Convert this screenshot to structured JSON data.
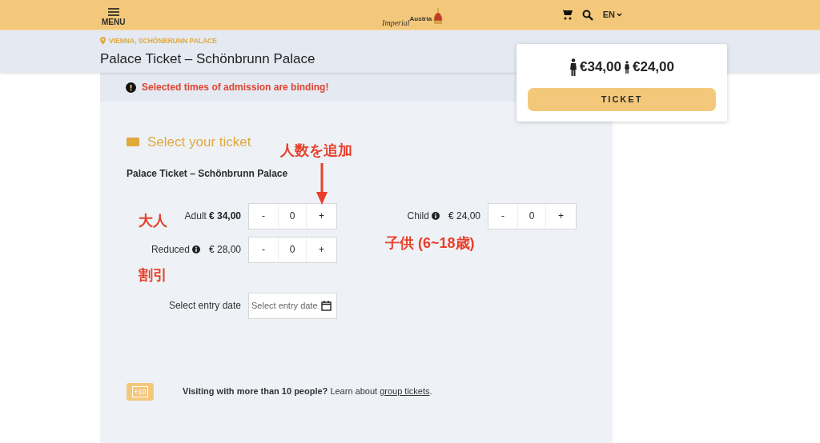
{
  "header": {
    "menu_label": "MENU",
    "logo": {
      "word_1": "Imperial",
      "word_2": "Austria"
    },
    "language": "EN"
  },
  "page": {
    "location": "VIENNA, SCHÖNBRUNN PALACE",
    "title": "Palace Ticket – Schönbrunn Palace"
  },
  "price_card": {
    "prices": [
      {
        "kind": "adult",
        "price": "€34,00"
      },
      {
        "kind": "child",
        "price": "€24,00"
      }
    ],
    "button": "TICKET"
  },
  "notice": "Selected times of admission are binding!",
  "ticket_section": {
    "heading": "Select your ticket",
    "product": "Palace Ticket – Schönbrunn Palace",
    "tickets": [
      {
        "name": "Adult",
        "info": false,
        "price": "€ 34,00",
        "minus": "-",
        "count": "0",
        "plus": "+"
      },
      {
        "name": "Child",
        "info": true,
        "price": "€ 24,00",
        "minus": "-",
        "count": "0",
        "plus": "+"
      },
      {
        "name": "Reduced",
        "info": true,
        "price": "€ 28,00",
        "minus": "-",
        "count": "0",
        "plus": "+"
      }
    ],
    "date": {
      "label": "Select entry date",
      "placeholder": "Select entry date"
    },
    "group": {
      "badge": "+10",
      "text": "**Visiting with more than 10 people?** Learn about",
      "link": "group tickets",
      "end": "."
    }
  },
  "annotations": [
    {
      "kind": "arrow-label",
      "text": "人数を追加"
    },
    {
      "kind": "adult",
      "text": "大人"
    },
    {
      "kind": "reduced",
      "text": "割引"
    },
    {
      "kind": "child",
      "text": "子供 (6~18歳)"
    }
  ]
}
